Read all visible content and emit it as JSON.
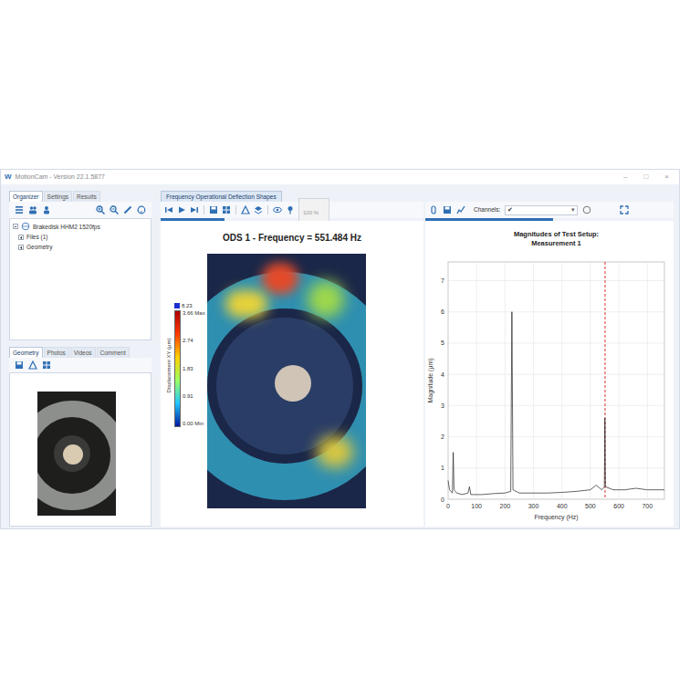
{
  "window": {
    "logo": "W",
    "title": "MotionCam - Version 22.1.5877",
    "controls": [
      "–",
      "□",
      "×"
    ]
  },
  "left": {
    "tabs": [
      {
        "label": "Organizer",
        "selected": true
      },
      {
        "label": "Settings",
        "selected": false
      },
      {
        "label": "Results",
        "selected": false
      }
    ],
    "tree": [
      {
        "label": "Brakedisk HHM2 1520fps",
        "expanded": true,
        "depth": 0
      },
      {
        "label": "Files (1)",
        "expanded": false,
        "depth": 1
      },
      {
        "label": "Geometry",
        "expanded": false,
        "depth": 1
      }
    ],
    "bottom_tabs": [
      {
        "label": "Geometry",
        "selected": true
      },
      {
        "label": "Photos",
        "selected": false
      },
      {
        "label": "Videos",
        "selected": false
      },
      {
        "label": "Comment",
        "selected": false
      }
    ]
  },
  "center": {
    "tab": "Frequency Operational Deflection Shapes",
    "zoom": "100 %",
    "title": "ODS 1 - Frequency = 551.484 Hz",
    "colorbar": {
      "label": "Displacement XY (µm)",
      "top": "8.23",
      "ticks": [
        "3.66 Max",
        "2.74",
        "1.83",
        "0.91",
        "0.00 Min"
      ]
    }
  },
  "right": {
    "channels_label": "Channels:",
    "channel_check": "✔",
    "dropdown_arrow": "▾",
    "chart": {
      "title": [
        "Magnitudes of Test Setup:",
        "Measurement 1"
      ],
      "y_label": "Magnitude (µm)",
      "x_label": "Frequency (Hz)",
      "y_ticks": [
        "0",
        "1",
        "2",
        "3",
        "4",
        "5",
        "6",
        "7"
      ],
      "x_ticks": [
        "0",
        "100",
        "200",
        "300",
        "400",
        "500",
        "600",
        "700"
      ],
      "marker": {
        "frequency": 551.484
      },
      "series": [
        {
          "frequency_hz": [
            0,
            5,
            10,
            15,
            18,
            21,
            30,
            50,
            70,
            75,
            80,
            120,
            160,
            200,
            220,
            224,
            228,
            250,
            300,
            350,
            400,
            450,
            500,
            520,
            540,
            549,
            551,
            553,
            580,
            620,
            660,
            700,
            740,
            760
          ],
          "magnitude_um": [
            0.6,
            0.3,
            0.25,
            0.2,
            1.5,
            0.3,
            0.2,
            0.15,
            0.2,
            0.4,
            0.15,
            0.15,
            0.18,
            0.2,
            0.25,
            6.0,
            0.3,
            0.2,
            0.2,
            0.2,
            0.22,
            0.25,
            0.3,
            0.45,
            0.3,
            0.4,
            2.6,
            0.4,
            0.3,
            0.3,
            0.35,
            0.3,
            0.3,
            0.3
          ]
        }
      ]
    }
  }
}
